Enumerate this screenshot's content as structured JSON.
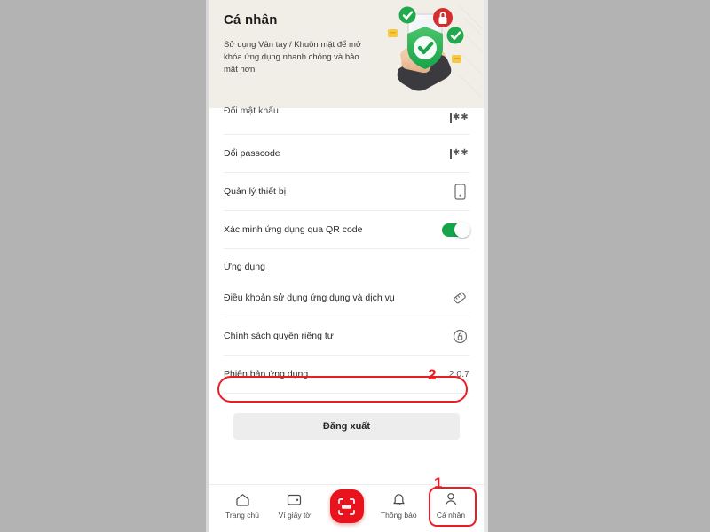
{
  "header": {
    "title": "Cá nhân",
    "subtitle": "Sử dụng Vân tay / Khuôn mặt để mở  khóa ứng dụng nhanh chóng và bảo mật hơn",
    "illustration_name": "phone-shield-security-illustration"
  },
  "list": {
    "rows": [
      {
        "label": "Đổi mật khẩu",
        "icon": "password-dots-icon",
        "value": "",
        "cut": true
      },
      {
        "label": "Đổi passcode",
        "icon": "password-dots-icon",
        "value": "",
        "cut": false
      },
      {
        "label": "Quản lý thiết bị",
        "icon": "device-phone-icon",
        "value": "",
        "cut": false
      },
      {
        "label": "Xác minh ứng dụng qua QR code",
        "icon": "toggle-switch-on",
        "value": "",
        "cut": false
      }
    ],
    "section_label": "Ứng dụng",
    "rows2": [
      {
        "label": "Điều khoản sử dụng ứng dụng và dịch vụ",
        "icon": "document-terms-icon"
      },
      {
        "label": "Chính sách quyền riêng tư",
        "icon": "lock-circle-icon"
      }
    ],
    "version_row": {
      "label": "Phiên bản ứng dụng",
      "value": "2.0.7",
      "marker": "2"
    }
  },
  "logout": {
    "label": "Đăng xuất"
  },
  "nav": {
    "items": [
      {
        "label": "Trang chủ",
        "icon": "home-icon"
      },
      {
        "label": "Ví giấy tờ",
        "icon": "wallet-icon"
      },
      {
        "label": "",
        "icon": "scan-qr-icon"
      },
      {
        "label": "Thông báo",
        "icon": "bell-icon"
      },
      {
        "label": "Cá nhân",
        "icon": "user-person-icon"
      }
    ],
    "marker": "1"
  },
  "colors": {
    "accent_red": "#ec1c24",
    "toggle_green": "#16a34a",
    "header_bg": "#f1eee8",
    "page_bg": "#b3b3b3"
  }
}
